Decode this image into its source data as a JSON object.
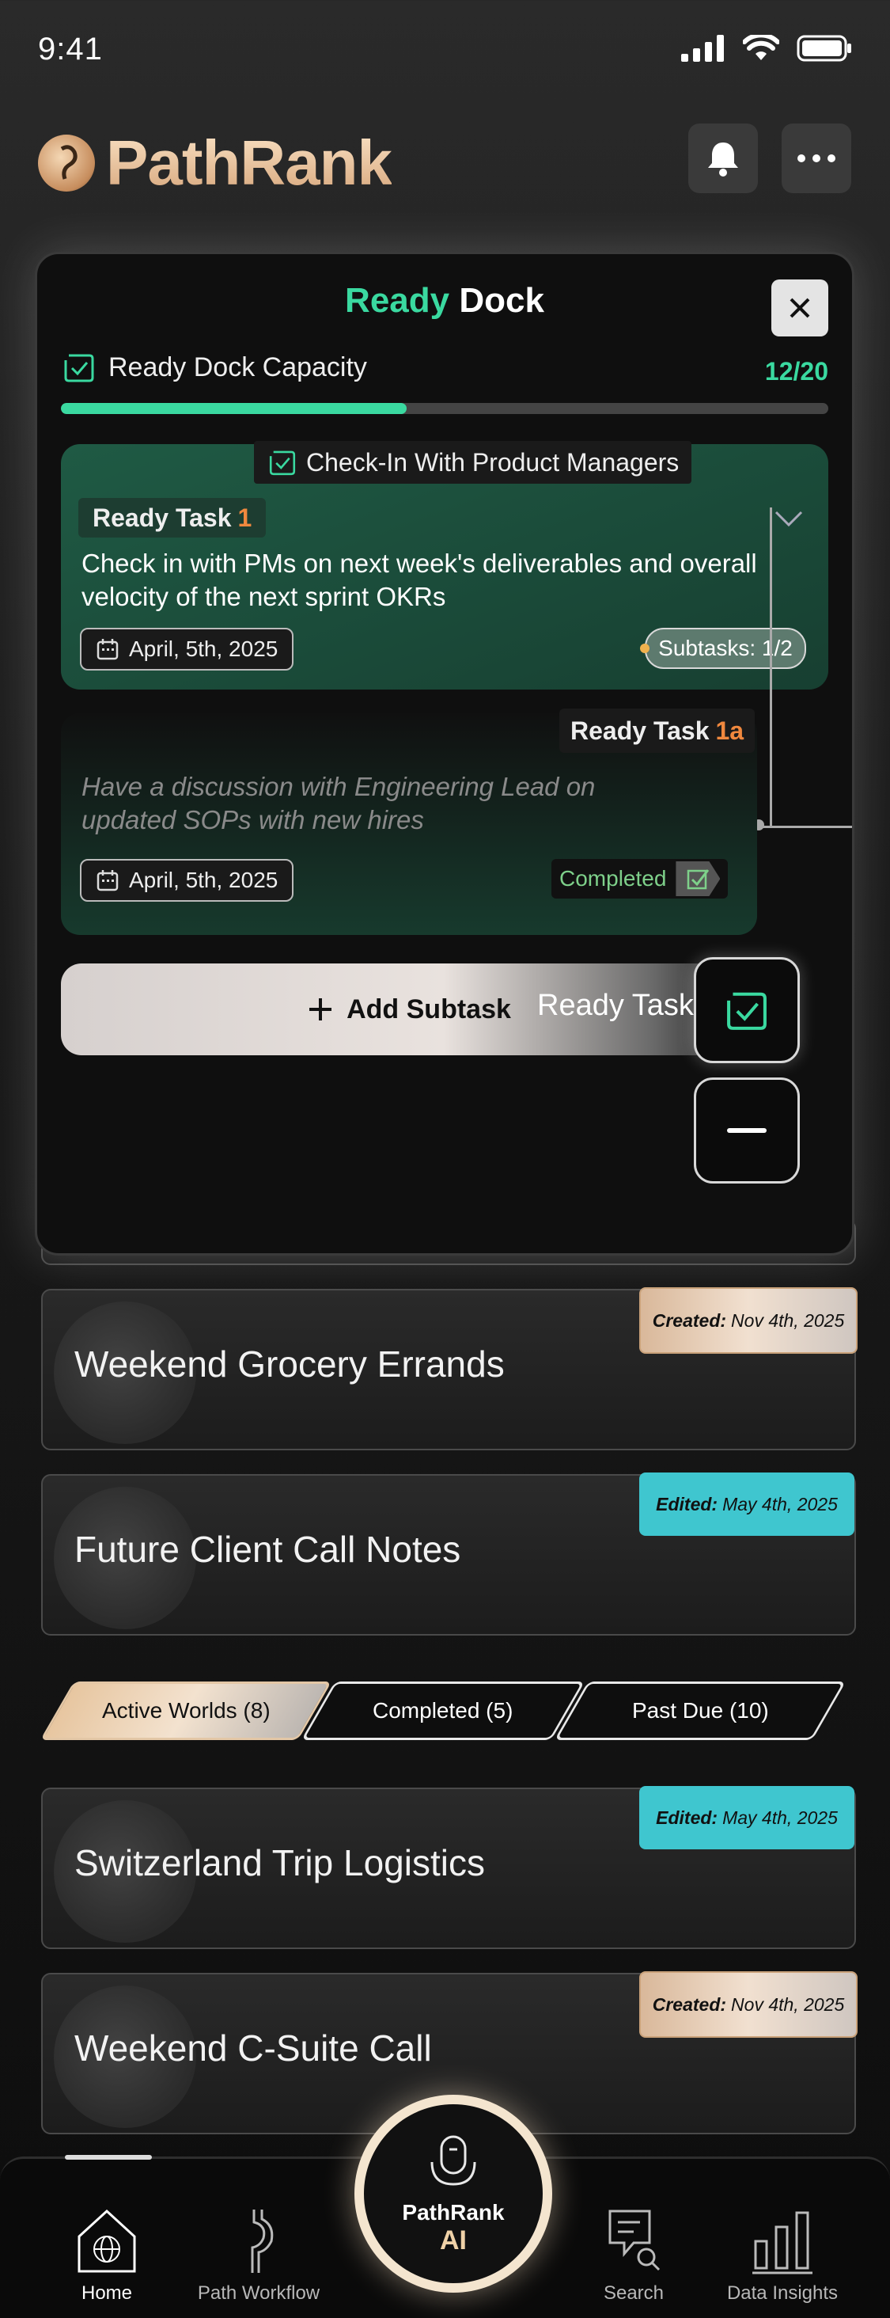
{
  "status_bar": {
    "time": "9:41"
  },
  "header": {
    "app_name": "PathRank"
  },
  "modal": {
    "title_accent": "Ready",
    "title_rest": " Dock",
    "capacity_label": "Ready Dock Capacity",
    "capacity_count": "12/20",
    "capacity_fraction": 0.45,
    "task1": {
      "tag": "Check-In With Product Managers",
      "label": "Ready Task",
      "number": "1",
      "description": "Check in with PMs on next week's deliverables and overall velocity of the next sprint OKRs",
      "date": "April, 5th, 2025",
      "subtasks": "Subtasks: 1/2"
    },
    "task2": {
      "label": "Ready Task",
      "number": "1a",
      "description": "Have a discussion with Engineering Lead on updated SOPs with new hires",
      "date": "April, 5th, 2025",
      "status": "Completed"
    },
    "add_subtask": "Add Subtask",
    "ready_task_label": "Ready Task"
  },
  "worlds": [
    {
      "title": "Weekend Grocery Errands",
      "badge_type": "created",
      "badge_label": "Created:",
      "badge_date": "Nov 4th, 2025"
    },
    {
      "title": "Future Client Call Notes",
      "badge_type": "edited",
      "badge_label": "Edited:",
      "badge_date": "May 4th, 2025"
    },
    {
      "title": "Switzerland Trip Logistics",
      "badge_type": "edited",
      "badge_label": "Edited:",
      "badge_date": "May 4th, 2025"
    },
    {
      "title": "Weekend C-Suite Call",
      "badge_type": "created",
      "badge_label": "Created:",
      "badge_date": "Nov 4th, 2025"
    }
  ],
  "tabs": {
    "active": "Active Worlds (8)",
    "completed": "Completed (5)",
    "past_due": "Past Due (10)"
  },
  "nav": {
    "home": "Home",
    "path_workflow": "Path Workflow",
    "ai_title": "PathRank",
    "ai_sub": "AI",
    "search": "Search",
    "data_insights": "Data Insights"
  },
  "colors": {
    "accent_green": "#3ad9a0",
    "accent_orange": "#f0883e",
    "badge_edited": "#3fc6cf"
  }
}
